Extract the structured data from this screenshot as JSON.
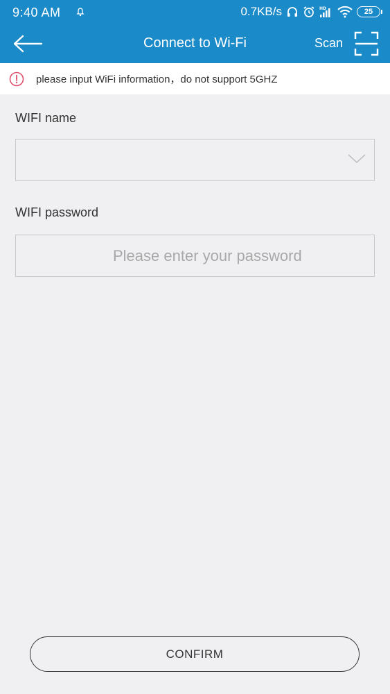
{
  "status_bar": {
    "time": "9:40 AM",
    "network_speed": "0.7KB/s",
    "battery_level": "25",
    "icons": [
      "bell-icon",
      "headphones-icon",
      "alarm-icon",
      "hd-signal-icon",
      "wifi-icon",
      "battery-icon"
    ]
  },
  "header": {
    "title": "Connect to Wi-Fi",
    "scan_label": "Scan",
    "back_icon": "back-arrow-icon",
    "scan_icon": "qr-scan-icon",
    "background_color": "#1b8ac8"
  },
  "notice": {
    "icon": "warning-circle-icon",
    "icon_color": "#e0506e",
    "text": "please input WiFi information，do not support 5GHZ"
  },
  "form": {
    "wifi_name": {
      "label": "WIFI name",
      "value": "",
      "icon": "chevron-down-icon"
    },
    "wifi_password": {
      "label": "WIFI password",
      "value": "",
      "placeholder": "Please enter your password"
    }
  },
  "confirm": {
    "label": "CONFIRM"
  }
}
